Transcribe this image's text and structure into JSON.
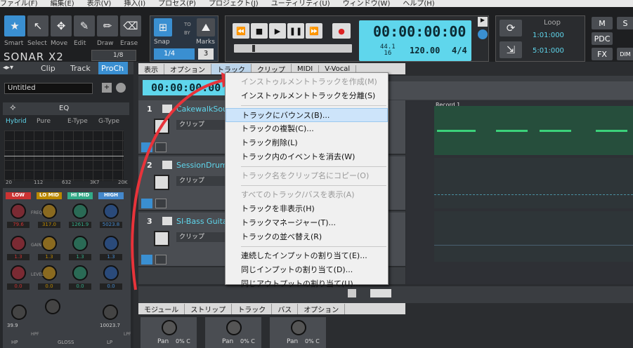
{
  "menubar": [
    "ファイル(F)",
    "編集(E)",
    "表示(V)",
    "挿入(I)",
    "プロセス(P)",
    "プロジェクト(J)",
    "ユーティリティ(U)",
    "ウィンドウ(W)",
    "ヘルプ(H)"
  ],
  "tools": [
    "Smart",
    "Select",
    "Move",
    "Edit",
    "Draw",
    "Erase"
  ],
  "brand": "SONAR X2",
  "snap": {
    "label": "Snap",
    "value": "1/4",
    "marks": "Marks",
    "to": "TO",
    "by": "BY",
    "num": "3"
  },
  "transport": {
    "time": "00:00:00:00",
    "rate": "44.1",
    "bits": "16",
    "tempo": "120.00",
    "meter": "4/4"
  },
  "loop": {
    "label": "Loop",
    "start": "1:01:000",
    "end": "5:01:000"
  },
  "right_buttons": [
    "M",
    "S",
    "PDC",
    "FX",
    "DIM"
  ],
  "left_tabs": [
    "Clip",
    "Track",
    "ProCh"
  ],
  "strip": {
    "name": "Untitled",
    "eq": "EQ",
    "modes": [
      "Hybrid",
      "Pure",
      "E-Type",
      "G-Type"
    ],
    "freqs": [
      "20",
      "112",
      "632",
      "3K7",
      "20K"
    ],
    "bands": [
      "LOW",
      "LO MID",
      "HI MID",
      "HIGH"
    ],
    "values": [
      "79.6",
      "317.0",
      "1261.9",
      "5023.8"
    ],
    "gains": [
      "1.3",
      "1.3",
      "1.3",
      "1.3"
    ],
    "zeros": [
      "0.0",
      "0.0",
      "0.0",
      "0.0"
    ],
    "bottom": [
      "39.9",
      "10023.7"
    ],
    "bottom_labels": [
      "HP",
      "GLOSS",
      "LP"
    ],
    "mini_fractions": [
      "1/8",
      "1/8"
    ],
    "side_labels": [
      "FREQ",
      "GAIN",
      "LEVEL",
      "HPF",
      "LPF"
    ]
  },
  "view_menu": [
    "表示",
    "オプション",
    "トラック",
    "クリップ",
    "MIDI",
    "V-Vocal"
  ],
  "track_time": "00:00:00:00",
  "clip_label": "クリップ",
  "tracks": [
    {
      "num": "1",
      "name": "CakewalkSou"
    },
    {
      "num": "2",
      "name": "SessionDrumm"
    },
    {
      "num": "3",
      "name": "SI-Bass Guita"
    }
  ],
  "ruler_mark": "Record 1",
  "dropdown": [
    {
      "label": "インストゥルメントトラックを作成(M)",
      "state": "dis"
    },
    {
      "label": "インストゥルメントトラックを分離(S)",
      "state": ""
    },
    {
      "sep": true
    },
    {
      "label": "トラックにバウンス(B)...",
      "state": "hl"
    },
    {
      "label": "トラックの複製(C)...",
      "state": ""
    },
    {
      "label": "トラック削除(L)",
      "state": ""
    },
    {
      "label": "トラック内のイベントを消去(W)",
      "state": ""
    },
    {
      "sep": true
    },
    {
      "label": "トラック名をクリップ名にコピー(O)",
      "state": "dis"
    },
    {
      "sep": true
    },
    {
      "label": "すべてのトラック/バスを表示(A)",
      "state": "dis"
    },
    {
      "label": "トラックを非表示(H)",
      "state": ""
    },
    {
      "label": "トラックマネージャー(T)...",
      "state": ""
    },
    {
      "label": "トラックの並べ替え(R)",
      "state": ""
    },
    {
      "sep": true
    },
    {
      "label": "連続したインプットの割り当て(E)...",
      "state": ""
    },
    {
      "label": "同じインプットの割り当て(D)...",
      "state": ""
    },
    {
      "label": "同じアウトプットの割り当て(U)...",
      "state": ""
    }
  ],
  "console_tabs": [
    "モジュール",
    "ストリップ",
    "トラック",
    "バス",
    "オプション"
  ],
  "pan": {
    "label": "Pan",
    "value": "0% C"
  }
}
